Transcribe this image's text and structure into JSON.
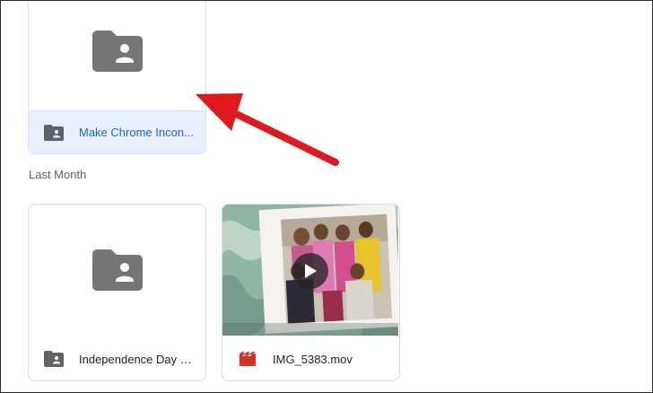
{
  "files": {
    "top_card": {
      "name": "Make Chrome Incon..."
    },
    "section_label": "Last Month",
    "cards": [
      {
        "name": "Independence Day 2..."
      },
      {
        "name": "IMG_5383.mov"
      }
    ]
  },
  "colors": {
    "selected_bg": "#e8f0fe",
    "selected_text": "#1967d2",
    "folder_gray": "#757575",
    "video_red": "#d93025",
    "annotation_red": "#e0191c"
  },
  "icons": {
    "folder": "shared-folder-icon",
    "video": "video-file-icon",
    "play": "play-icon",
    "annotation": "red-arrow"
  }
}
